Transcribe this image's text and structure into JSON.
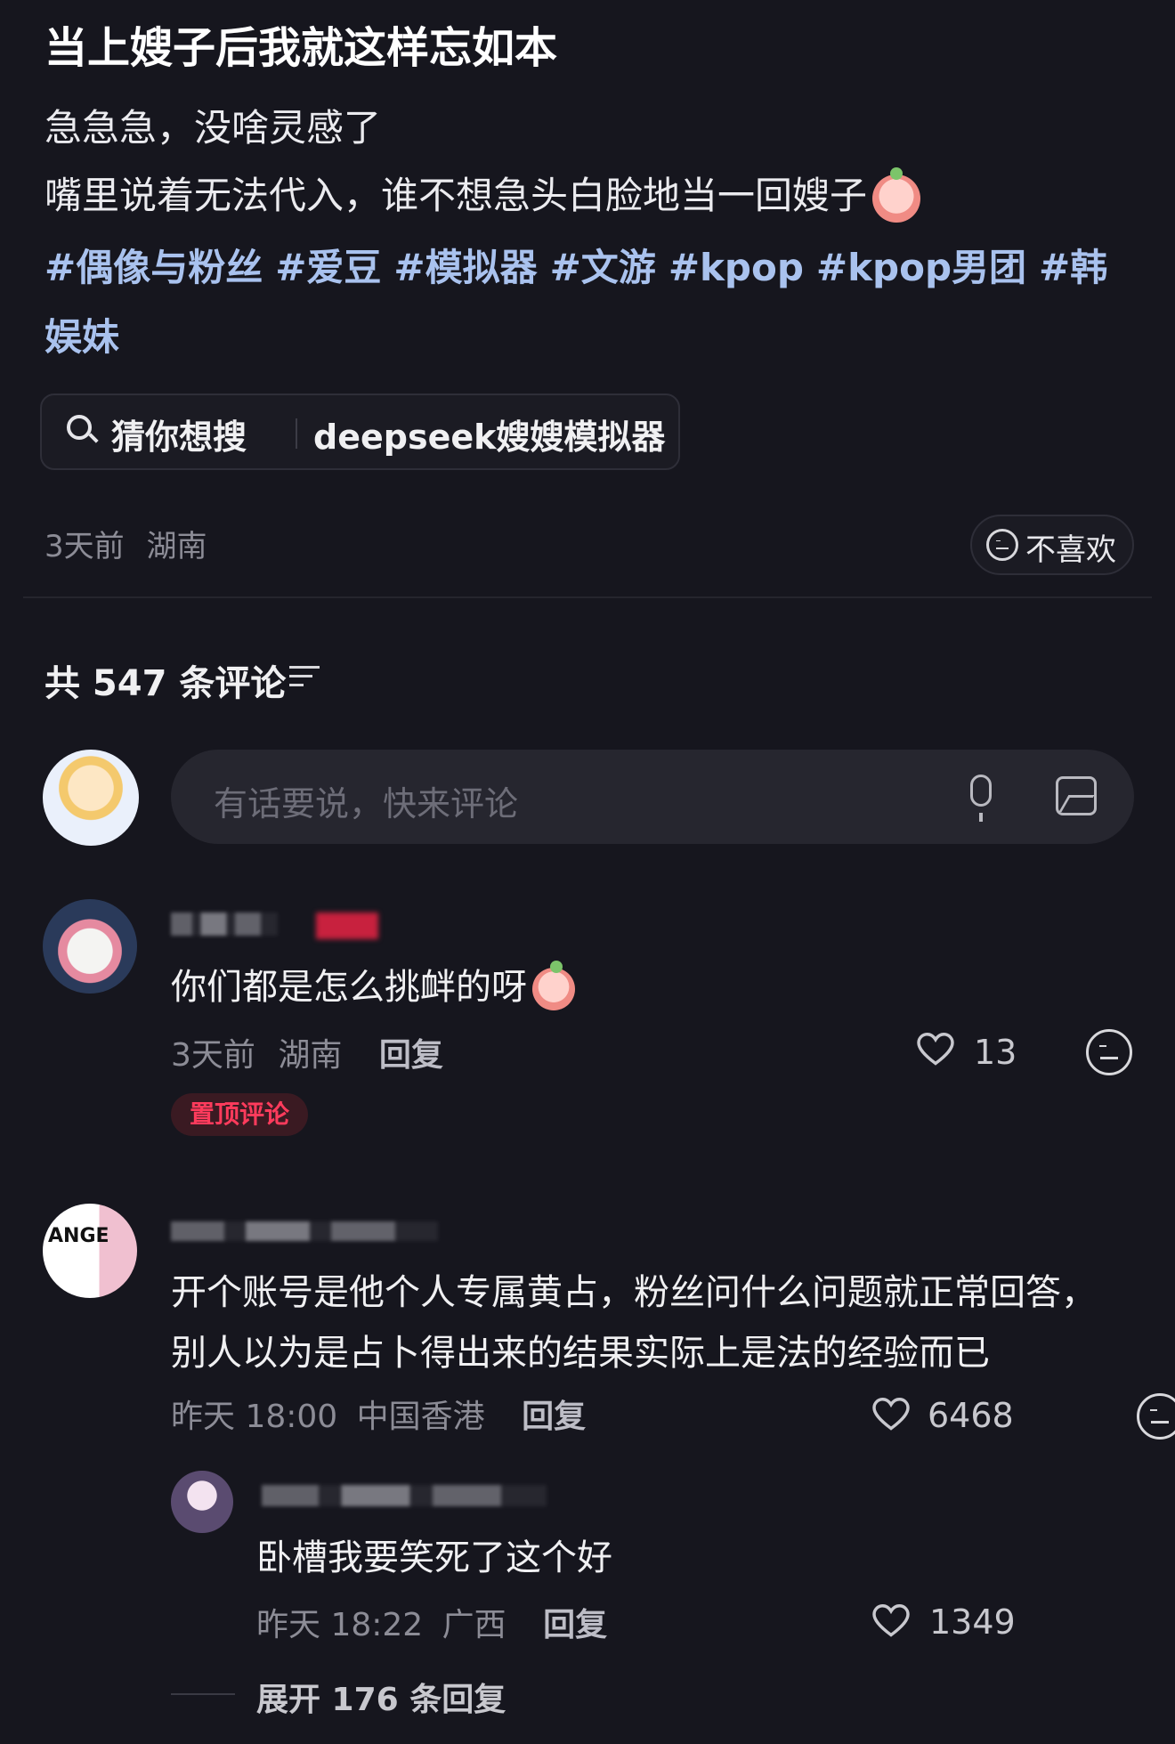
{
  "post": {
    "title": "当上嫂子后我就这样忘如本",
    "line1": "急急急，没啥灵感了",
    "line2": "嘴里说着无法代入，谁不想急头白脸地当一回嫂子",
    "tags": [
      "#偶像与粉丝",
      "#爱豆",
      "#模拟器",
      "#文游",
      "#kpop",
      "#kpop男团",
      "#韩娱妹"
    ],
    "time": "3天前",
    "location": "湖南",
    "dislike_label": "不喜欢"
  },
  "search": {
    "label": "猜你想搜",
    "query": "deepseek嫂嫂模拟器",
    "icon": "search-icon"
  },
  "comments_header": {
    "count_text": "共 547 条评论",
    "icon": "filter-icon"
  },
  "composer": {
    "placeholder": "有话要说，快来评论",
    "icons": [
      "mic-icon",
      "image-icon"
    ]
  },
  "comments": [
    {
      "text": "你们都是怎么挑衅的呀",
      "time": "3天前",
      "location": "湖南",
      "reply_label": "回复",
      "likes": "13",
      "badge": "置顶评论"
    },
    {
      "text": "开个账号是他个人专属黄占，粉丝问什么问题就正常回答，别人以为是占卜得出来的结果实际上是法的经验而已",
      "time": "昨天 18:00",
      "location": "中国香港",
      "reply_label": "回复",
      "likes": "6468",
      "replies": [
        {
          "text": "卧槽我要笑死了这个好",
          "time": "昨天 18:22",
          "location": "广西",
          "reply_label": "回复",
          "likes": "1349"
        }
      ],
      "expand_label": "展开 176 条回复"
    }
  ],
  "colors": {
    "background": "#16161e",
    "tag": "#a9c2ee",
    "pin_badge": "#ff3b5c"
  }
}
